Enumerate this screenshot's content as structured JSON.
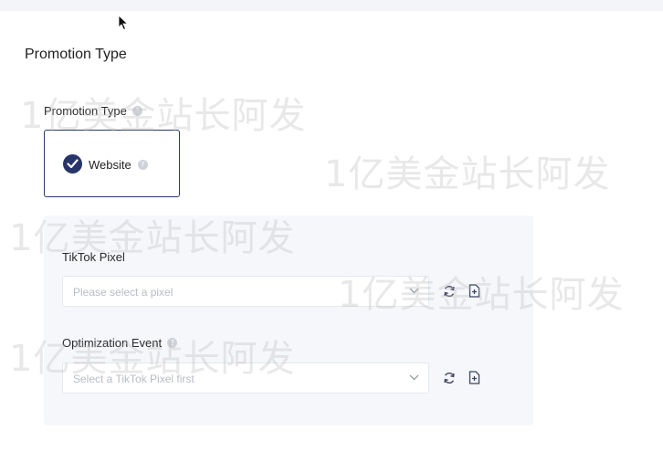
{
  "promotion": {
    "section_title": "Promotion Type",
    "field_label": "Promotion Type",
    "option": {
      "label": "Website",
      "selected": true
    }
  },
  "pixel": {
    "label": "TikTok Pixel",
    "placeholder": "Please select a pixel"
  },
  "optimization": {
    "label": "Optimization Event",
    "placeholder": "Select a TikTok Pixel first"
  },
  "icons": {
    "help": "question-circle-icon",
    "check": "check-circle-icon",
    "chevron": "chevron-down-icon",
    "refresh": "refresh-icon",
    "add_file": "file-add-icon",
    "cursor": "mouse-cursor-icon"
  },
  "colors": {
    "accent": "#28356a",
    "panel_bg": "#f6f7fb",
    "placeholder": "#b8bcc6"
  },
  "watermark": "1亿美金站长阿发"
}
